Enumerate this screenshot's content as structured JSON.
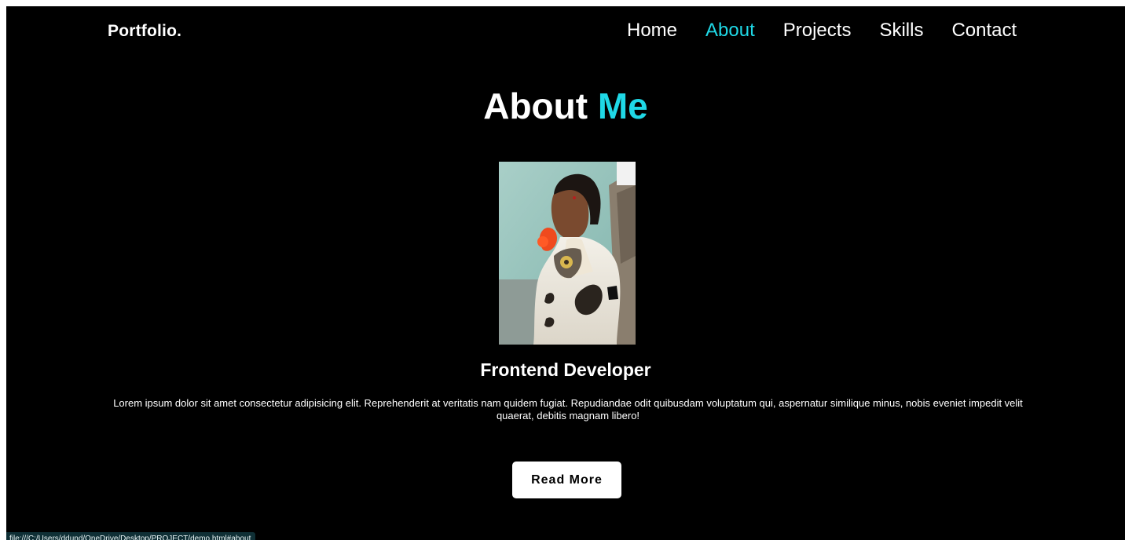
{
  "colors": {
    "accent": "#1fd8e6",
    "background": "#000000",
    "text": "#ffffff"
  },
  "navbar": {
    "brand": "Portfolio.",
    "links": [
      {
        "label": "Home",
        "active": false
      },
      {
        "label": "About",
        "active": true
      },
      {
        "label": "Projects",
        "active": false
      },
      {
        "label": "Skills",
        "active": false
      },
      {
        "label": "Contact",
        "active": false
      }
    ]
  },
  "about": {
    "title_main": "About",
    "title_accent": "Me",
    "photo": "profile-photo",
    "role": "Frontend Developer",
    "bio": "Lorem ipsum dolor sit amet consectetur adipisicing elit. Reprehenderit at veritatis nam quidem fugiat. Repudiandae odit quibusdam voluptatum qui, aspernatur similique minus, nobis eveniet impedit velit quaerat, debitis magnam libero!",
    "button_label": "Read More"
  },
  "status_bar": {
    "url": "file:///C:/Users/ddund/OneDrive/Desktop/PROJECT/demo.html#about"
  }
}
